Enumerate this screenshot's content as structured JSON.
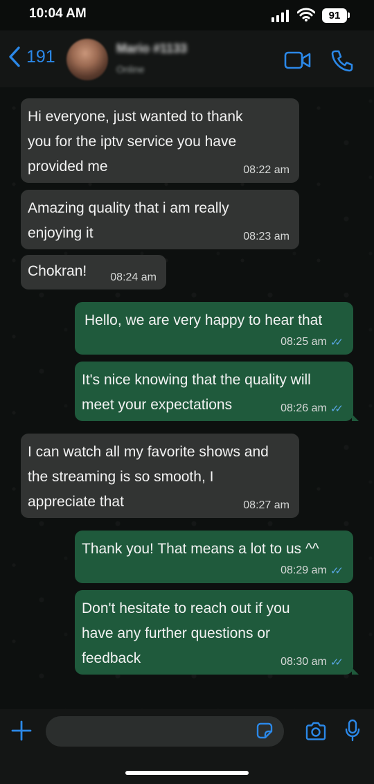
{
  "status_bar": {
    "time": "10:04 AM",
    "battery": "91"
  },
  "header": {
    "back_count": "191",
    "contact_name": "Mario #1133",
    "contact_status": "Online"
  },
  "messages": [
    {
      "direction": "in",
      "text": "Hi everyone, just wanted to thank\nyou for the iptv service you have\nprovided me",
      "time": "08:22 am"
    },
    {
      "direction": "in",
      "text": "Amazing quality that i am really\nenjoying it",
      "time": "08:23 am"
    },
    {
      "direction": "in",
      "text": "Chokran!",
      "time": "08:24 am"
    },
    {
      "direction": "out",
      "text": "Hello, we are very happy to hear that",
      "time": "08:25 am",
      "read": true
    },
    {
      "direction": "out",
      "text": "It's nice knowing that the quality will\nmeet your expectations",
      "time": "08:26 am",
      "read": true
    },
    {
      "direction": "in",
      "text": "I can watch all my favorite shows and\nthe streaming is so smooth, I\nappreciate that",
      "time": "08:27 am"
    },
    {
      "direction": "out",
      "text": "Thank you! That means a lot to us ^^",
      "time": "08:29 am",
      "read": true
    },
    {
      "direction": "out",
      "text": "Don't hesitate to reach out if you\nhave any further questions or\nfeedback",
      "time": "08:30 am",
      "read": true
    }
  ],
  "composer": {
    "placeholder": ""
  },
  "colors": {
    "accent": "#2b88e8",
    "incoming": "#323433",
    "outgoing": "#1f5a3c",
    "read_ticks": "#5aa7e6"
  },
  "icons": [
    "back-chevron-icon",
    "video-call-icon",
    "phone-icon",
    "plus-icon",
    "sticker-icon",
    "camera-icon",
    "microphone-icon"
  ]
}
